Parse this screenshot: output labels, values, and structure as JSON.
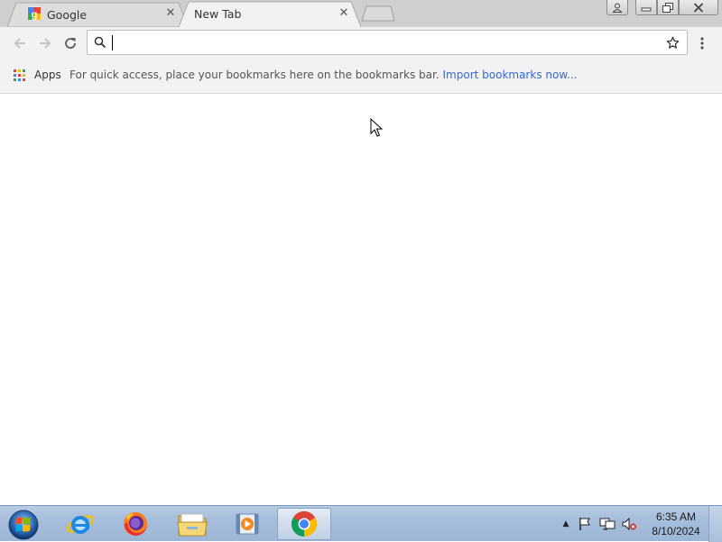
{
  "tabs": [
    {
      "label": "Google",
      "active": false,
      "icon": "google-favicon"
    },
    {
      "label": "New Tab",
      "active": true
    }
  ],
  "window_controls": [
    "profile-icon",
    "minimize-icon",
    "restore-icon",
    "close-icon"
  ],
  "toolbar": {
    "back": "back-icon",
    "forward": "forward-icon",
    "reload": "reload-icon",
    "omnibox": {
      "value": "",
      "placeholder": ""
    },
    "star": "star-icon",
    "menu": "menu-icon"
  },
  "bookmarks_bar": {
    "apps_label": "Apps",
    "hint": "For quick access, place your bookmarks here on the bookmarks bar.",
    "import_link": "Import bookmarks now..."
  },
  "taskbar": {
    "apps": [
      "internet-explorer",
      "firefox",
      "file-explorer",
      "media-player",
      "chrome"
    ],
    "active_app": "chrome",
    "clock": {
      "time": "6:35 AM",
      "date": "8/10/2024"
    }
  },
  "colors": {
    "tabstrip": "#cfcfcf",
    "toolbar": "#f2f2f2",
    "link": "#3367d6",
    "taskbar": "#a6bedb"
  }
}
